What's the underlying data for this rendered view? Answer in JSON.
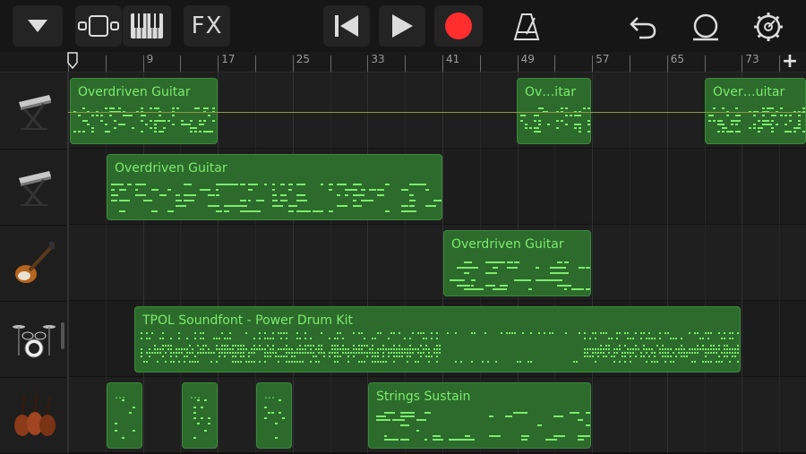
{
  "toolbar": {
    "fx_label": "FX"
  },
  "ruler": {
    "bar_labels": [
      "9",
      "17",
      "25",
      "33",
      "41",
      "49",
      "57",
      "65",
      "73"
    ],
    "add_label": "+"
  },
  "tracks": [
    {
      "instrument_icon": "keyboard-icon"
    },
    {
      "instrument_icon": "keyboard-icon"
    },
    {
      "instrument_icon": "bass-guitar-icon"
    },
    {
      "instrument_icon": "drum-kit-icon"
    },
    {
      "instrument_icon": "strings-icon"
    }
  ],
  "regions": [
    {
      "track": 0,
      "name": "Overdriven Guitar"
    },
    {
      "track": 0,
      "name": "Ov…itar"
    },
    {
      "track": 0,
      "name": "Over…uitar"
    },
    {
      "track": 1,
      "name": "Overdriven Guitar"
    },
    {
      "track": 2,
      "name": "Overdriven Guitar"
    },
    {
      "track": 3,
      "name": "TPOL Soundfont - Power Drum Kit"
    },
    {
      "track": 4,
      "name": "…"
    },
    {
      "track": 4,
      "name": "…"
    },
    {
      "track": 4,
      "name": "…"
    },
    {
      "track": 4,
      "name": "Strings Sustain"
    }
  ],
  "colors": {
    "region_fill": "#2c6b2c",
    "region_text": "#7dea6e",
    "note": "#7dea6e",
    "record": "#ff2d2d"
  }
}
